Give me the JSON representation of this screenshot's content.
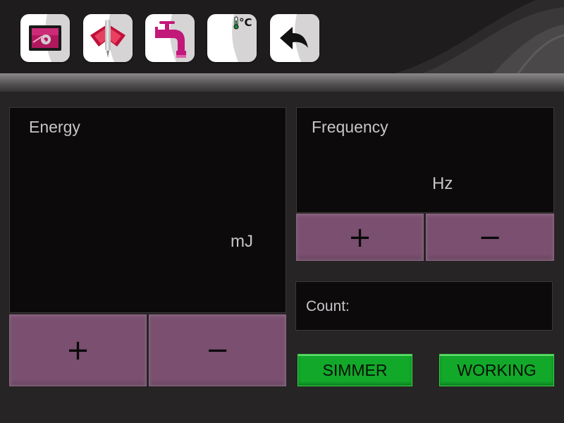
{
  "toolbar": {
    "buttons": [
      {
        "name": "settings-monitor-button",
        "icon": "monitor-gear-icon"
      },
      {
        "name": "laser-handpiece-button",
        "icon": "winged-handpiece-icon"
      },
      {
        "name": "water-tap-button",
        "icon": "water-tap-icon"
      },
      {
        "name": "temperature-button",
        "icon": "thermometer-icon",
        "label": "°C"
      },
      {
        "name": "back-button",
        "icon": "back-arrow-icon"
      }
    ]
  },
  "energy": {
    "title": "Energy",
    "unit": "mJ",
    "plus": "+",
    "minus": "−"
  },
  "frequency": {
    "title": "Frequency",
    "unit": "Hz",
    "plus": "+",
    "minus": "−"
  },
  "count": {
    "label": "Count:"
  },
  "status_buttons": {
    "simmer": "SIMMER",
    "working": "WORKING"
  },
  "colors": {
    "background": "#262424",
    "panel": "#0c0a0b",
    "adjust_button": "#7a4f70",
    "status_button": "#12a82a",
    "accent_magenta": "#c2187a"
  }
}
